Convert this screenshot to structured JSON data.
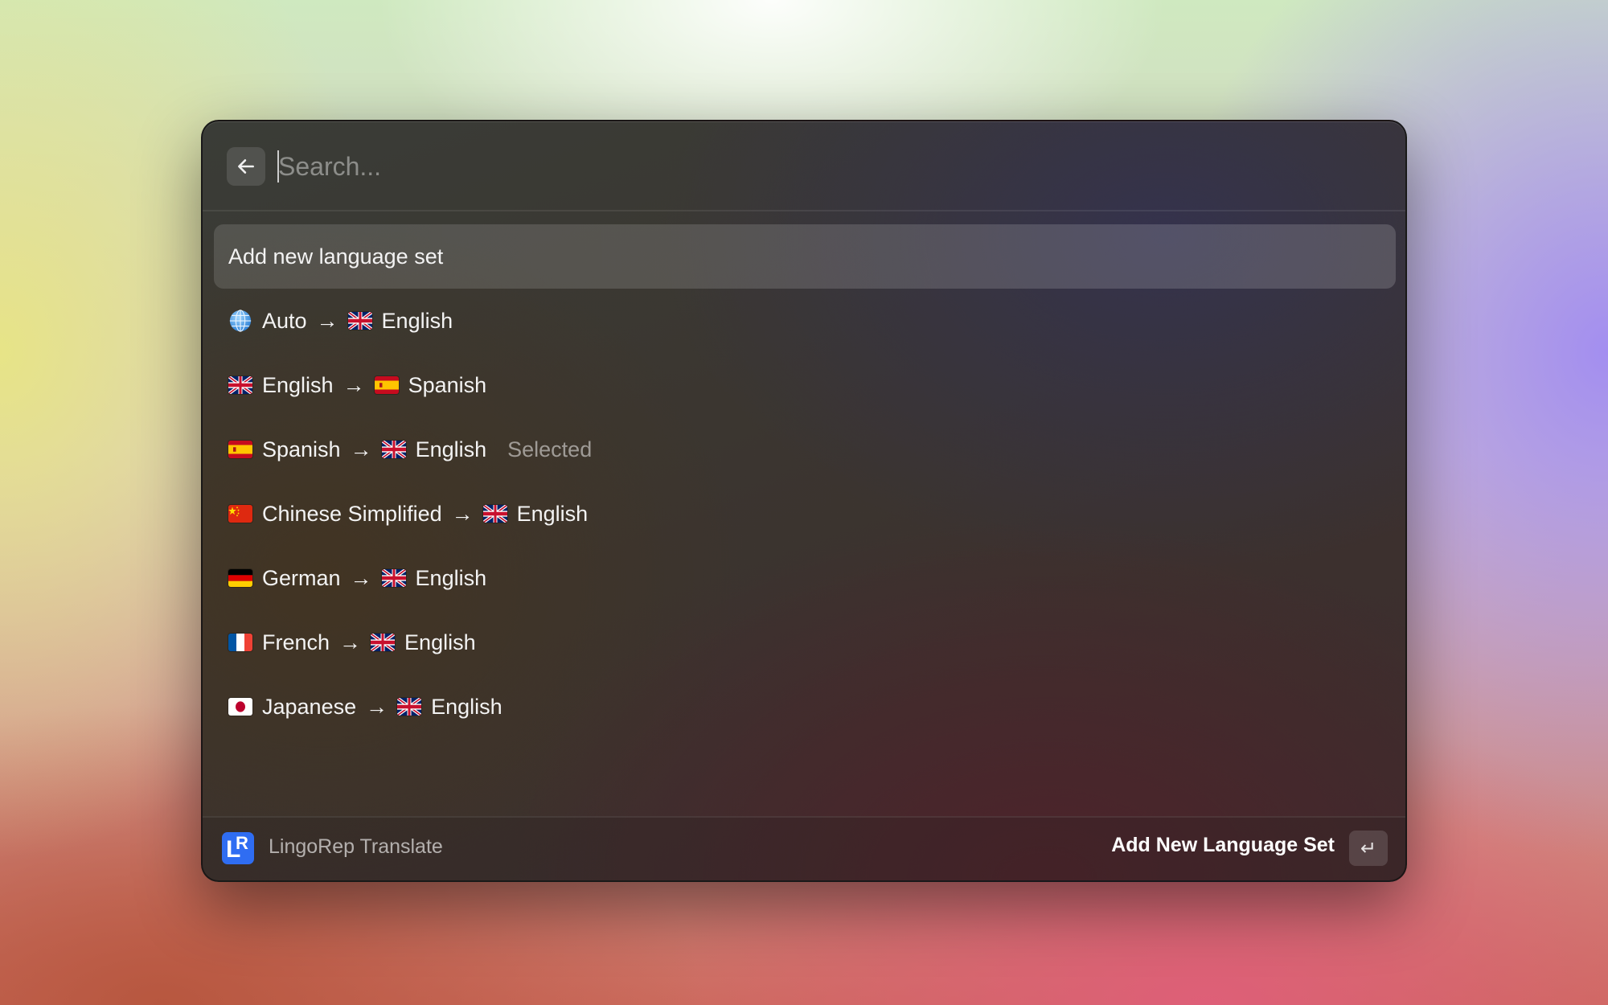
{
  "search": {
    "placeholder": "Search...",
    "value": ""
  },
  "list": {
    "add_item": {
      "label": "Add new language set"
    },
    "items": [
      {
        "source_icon": "globe-icon",
        "source": "Auto",
        "arrow": "→",
        "target_icon": "flag-uk-icon",
        "target": "English",
        "accessory": ""
      },
      {
        "source_icon": "flag-uk-icon",
        "source": "English",
        "arrow": "→",
        "target_icon": "flag-spain-icon",
        "target": "Spanish",
        "accessory": ""
      },
      {
        "source_icon": "flag-spain-icon",
        "source": "Spanish",
        "arrow": "→",
        "target_icon": "flag-uk-icon",
        "target": "English",
        "accessory": "Selected"
      },
      {
        "source_icon": "flag-china-icon",
        "source": "Chinese Simplified",
        "arrow": "→",
        "target_icon": "flag-uk-icon",
        "target": "English",
        "accessory": ""
      },
      {
        "source_icon": "flag-germany-icon",
        "source": "German",
        "arrow": "→",
        "target_icon": "flag-uk-icon",
        "target": "English",
        "accessory": ""
      },
      {
        "source_icon": "flag-france-icon",
        "source": "French",
        "arrow": "→",
        "target_icon": "flag-uk-icon",
        "target": "English",
        "accessory": ""
      },
      {
        "source_icon": "flag-japan-icon",
        "source": "Japanese",
        "arrow": "→",
        "target_icon": "flag-uk-icon",
        "target": "English",
        "accessory": ""
      }
    ]
  },
  "footer": {
    "app_logo_text": "LR",
    "app_name": "LingoRep Translate",
    "primary_action": "Add New Language Set",
    "enter_key_icon": "return-key-icon",
    "enter_key_glyph": "↵"
  },
  "colors": {
    "logo_blue": "#2f6df2",
    "text_primary": "#f3f3f3",
    "text_muted": "rgba(255,255,255,0.5)"
  }
}
